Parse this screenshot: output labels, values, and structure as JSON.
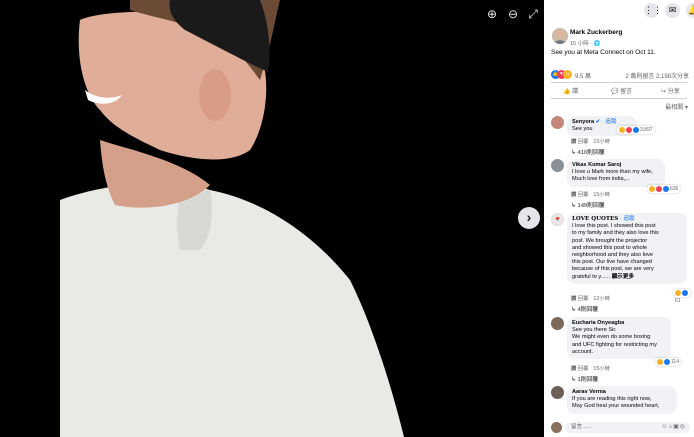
{
  "viewer": {
    "zoom_in_icon": "zoom-in-icon",
    "zoom_out_icon": "zoom-out-icon",
    "fullscreen_icon": "fullscreen-icon",
    "next_glyph": "›"
  },
  "post": {
    "author": "Mark Zuckerberg",
    "time": "15 小時 ·",
    "text": "See you at Meta Connect on Oct 11.",
    "reaction_count": "9.5 萬",
    "stats": "2 萬則留言   2,198次分享",
    "actions": {
      "like": "讚",
      "comment": "留言",
      "share": "分享"
    },
    "sort": "最相關"
  },
  "comments": [
    {
      "name": "Senyora",
      "tag": "· 追蹤",
      "lines": [
        "See you"
      ],
      "reaction_count": "3,897",
      "like": "讚",
      "reply": "回覆",
      "time": "15小時",
      "replies": "410則回覆",
      "avatar_color": "#c4877a"
    },
    {
      "name": "Vikas Kumar Saroj",
      "tag": "",
      "lines": [
        "I love u Mark more than my wife,",
        "Much love from india,,.."
      ],
      "reaction_count": "636",
      "like": "讚",
      "reply": "回覆",
      "time": "15小時",
      "replies": "149則回覆",
      "avatar_color": "#8b8f96"
    },
    {
      "name": "LOVE QUOTES",
      "tag": "· 追蹤",
      "lines": [
        "I love this post. I showed this post",
        "to my family and they also love this",
        "post. We brought the projector",
        "and showed this post to whole",
        "neighborhood and they also love",
        "this post. Our live have changed",
        "because of this post, we are very",
        "grateful to y......"
      ],
      "see_more": "顯示更多",
      "reaction_count": "61",
      "like": "讚",
      "reply": "回覆",
      "time": "12小時",
      "replies": "4則回覆",
      "avatar_color": "#e8e2e2"
    },
    {
      "name": "Eucharia Onyeagba",
      "tag": "",
      "lines": [
        "See you there Sir.",
        "We might even do some boxing",
        "and UFC fighting for restricting my",
        "account."
      ],
      "reaction_count": "114",
      "like": "讚",
      "reply": "回覆",
      "time": "15小時",
      "replies": "1則回覆",
      "avatar_color": "#7d6a5c"
    },
    {
      "name": "Aarav Verma",
      "tag": "",
      "lines": [
        "If you are reading this right now,",
        "May God heal your wounded heart,"
      ],
      "avatar_color": "#6d5f55"
    }
  ],
  "composer": {
    "placeholder": "留言......",
    "icons": [
      "emoji-icon",
      "camera-icon",
      "gif-icon",
      "sticker-icon"
    ]
  },
  "colors": {
    "accent": "#1877f2",
    "like_blue": "#1877f2",
    "love_red": "#f33e58",
    "haha_yellow": "#f7b125"
  }
}
